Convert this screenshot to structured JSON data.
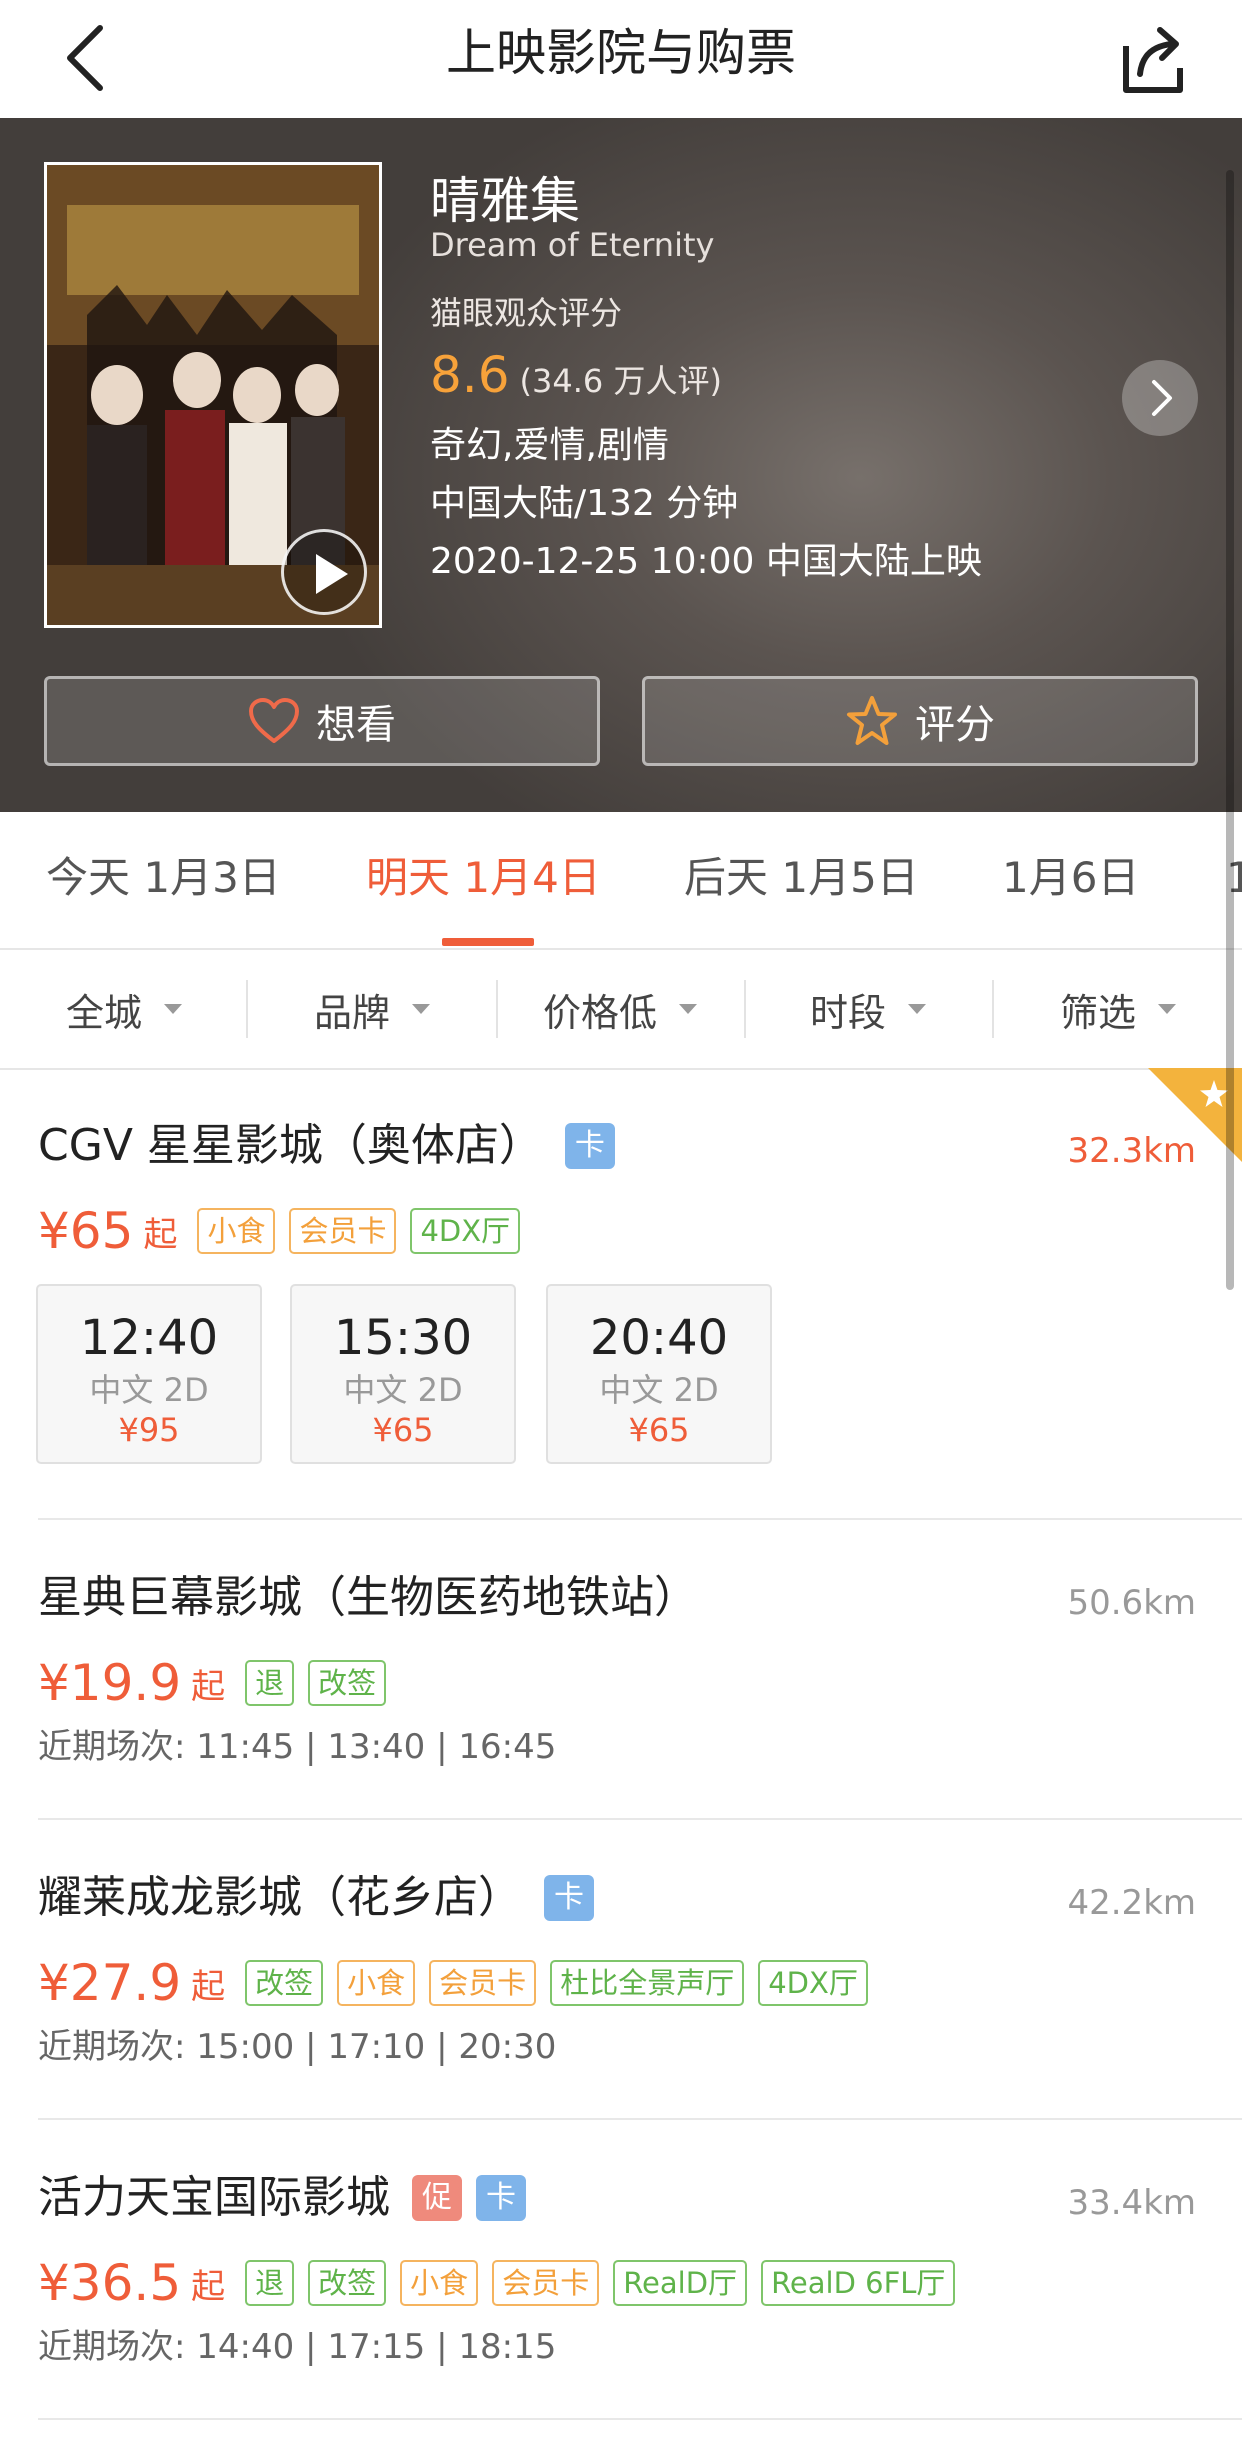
{
  "nav": {
    "title": "上映影院与购票",
    "back_icon": "chevron-left-icon",
    "share_icon": "share-icon"
  },
  "movie": {
    "title": "晴雅集",
    "english_title": "Dream of Eternity",
    "rating_label": "猫眼观众评分",
    "score": "8.6",
    "rating_count": "(34.6 万人评)",
    "genres": "奇幻,爱情,剧情",
    "origin_duration": "中国大陆/132 分钟",
    "release": "2020-12-25 10:00 中国大陆上映",
    "want_label": "想看",
    "rate_label": "评分"
  },
  "date_tabs": [
    {
      "label": "今天 1月3日",
      "active": false
    },
    {
      "label": "明天 1月4日",
      "active": true
    },
    {
      "label": "后天 1月5日",
      "active": false
    },
    {
      "label": "1月6日",
      "active": false
    },
    {
      "label": "1",
      "active": false
    }
  ],
  "filters": [
    {
      "label": "全城"
    },
    {
      "label": "品牌"
    },
    {
      "label": "价格低"
    },
    {
      "label": "时段"
    },
    {
      "label": "筛选"
    }
  ],
  "cinemas": [
    {
      "name": "CGV 星星影城（奥体店）",
      "badges": [
        "卡"
      ],
      "distance": "32.3km",
      "price": "¥65",
      "price_suffix": "起",
      "tags": [
        "小食",
        "会员卡",
        "4DX厅"
      ],
      "showtimes": [
        {
          "time": "12:40",
          "lang": "中文 2D",
          "price": "¥95"
        },
        {
          "time": "15:30",
          "lang": "中文 2D",
          "price": "¥65"
        },
        {
          "time": "20:40",
          "lang": "中文 2D",
          "price": "¥65"
        }
      ]
    },
    {
      "name": "星典巨幕影城（生物医药地铁站）",
      "badges": [],
      "distance": "50.6km",
      "price": "¥19.9",
      "price_suffix": "起",
      "tags": [
        "退",
        "改签"
      ],
      "recent": "近期场次: 11:45 | 13:40 | 16:45"
    },
    {
      "name": "耀莱成龙影城（花乡店）",
      "badges": [
        "卡"
      ],
      "distance": "42.2km",
      "price": "¥27.9",
      "price_suffix": "起",
      "tags": [
        "改签",
        "小食",
        "会员卡",
        "杜比全景声厅",
        "4DX厅"
      ],
      "recent": "近期场次: 15:00 | 17:10 | 20:30"
    },
    {
      "name": "活力天宝国际影城",
      "badges": [
        "促",
        "卡"
      ],
      "distance": "33.4km",
      "price": "¥36.5",
      "price_suffix": "起",
      "tags": [
        "退",
        "改签",
        "小食",
        "会员卡",
        "RealD厅",
        "RealD 6FL厅"
      ],
      "recent": "近期场次: 14:40 | 17:15 | 18:15"
    }
  ],
  "colors": {
    "accent": "#ef5d39",
    "score": "#f7a23a",
    "tag_green": "#5fb34a",
    "tag_orange": "#f3a03b",
    "badge_card": "#7fb4ea",
    "badge_promo": "#ef8a7c",
    "ribbon": "#f3b33d"
  }
}
